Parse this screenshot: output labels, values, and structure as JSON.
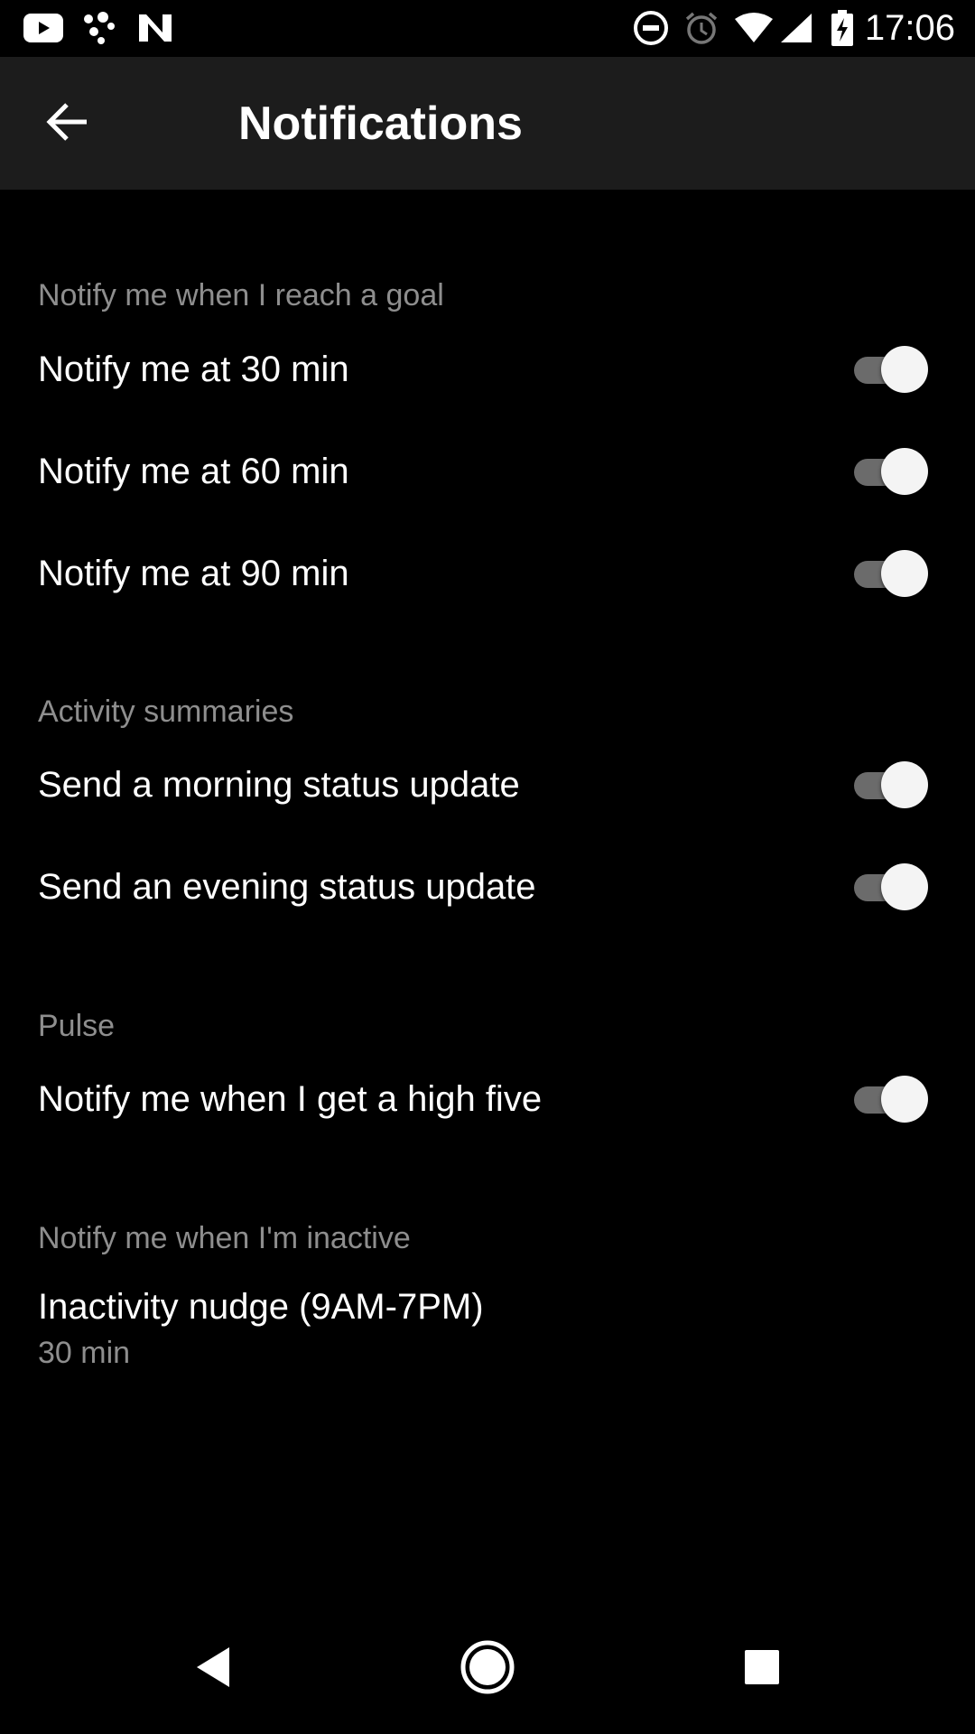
{
  "status_bar": {
    "time": "17:06",
    "left_icons": [
      "youtube-icon",
      "app-dots-icon",
      "n-logo-icon"
    ],
    "right_icons": [
      "do-not-disturb-icon",
      "alarm-icon",
      "wifi-icon",
      "cell-signal-icon",
      "battery-charging-icon"
    ]
  },
  "app_bar": {
    "title": "Notifications",
    "back_icon": "arrow-left-icon"
  },
  "sections": [
    {
      "header": "Notify me when I reach a goal",
      "items": [
        {
          "label": "Notify me at 30 min",
          "checked": true
        },
        {
          "label": "Notify me at 60 min",
          "checked": true
        },
        {
          "label": "Notify me at 90 min",
          "checked": true
        }
      ]
    },
    {
      "header": "Activity summaries",
      "items": [
        {
          "label": "Send a morning status update",
          "checked": true
        },
        {
          "label": "Send an evening status update",
          "checked": true
        }
      ]
    },
    {
      "header": "Pulse",
      "items": [
        {
          "label": "Notify me when I get a high five",
          "checked": true
        }
      ]
    },
    {
      "header": "Notify me when I'm inactive",
      "items": [
        {
          "label": "Inactivity nudge (9AM-7PM)",
          "value": "30 min"
        }
      ]
    }
  ],
  "nav_bar": {
    "back_icon": "nav-back-triangle-icon",
    "home_icon": "nav-home-circle-icon",
    "recents_icon": "nav-recents-square-icon"
  },
  "colors": {
    "background": "#000000",
    "app_bar": "#1c1c1c",
    "section_header": "#8e8e8e",
    "toggle_track": "#6b6b6b",
    "toggle_thumb": "#f4f4f4"
  }
}
